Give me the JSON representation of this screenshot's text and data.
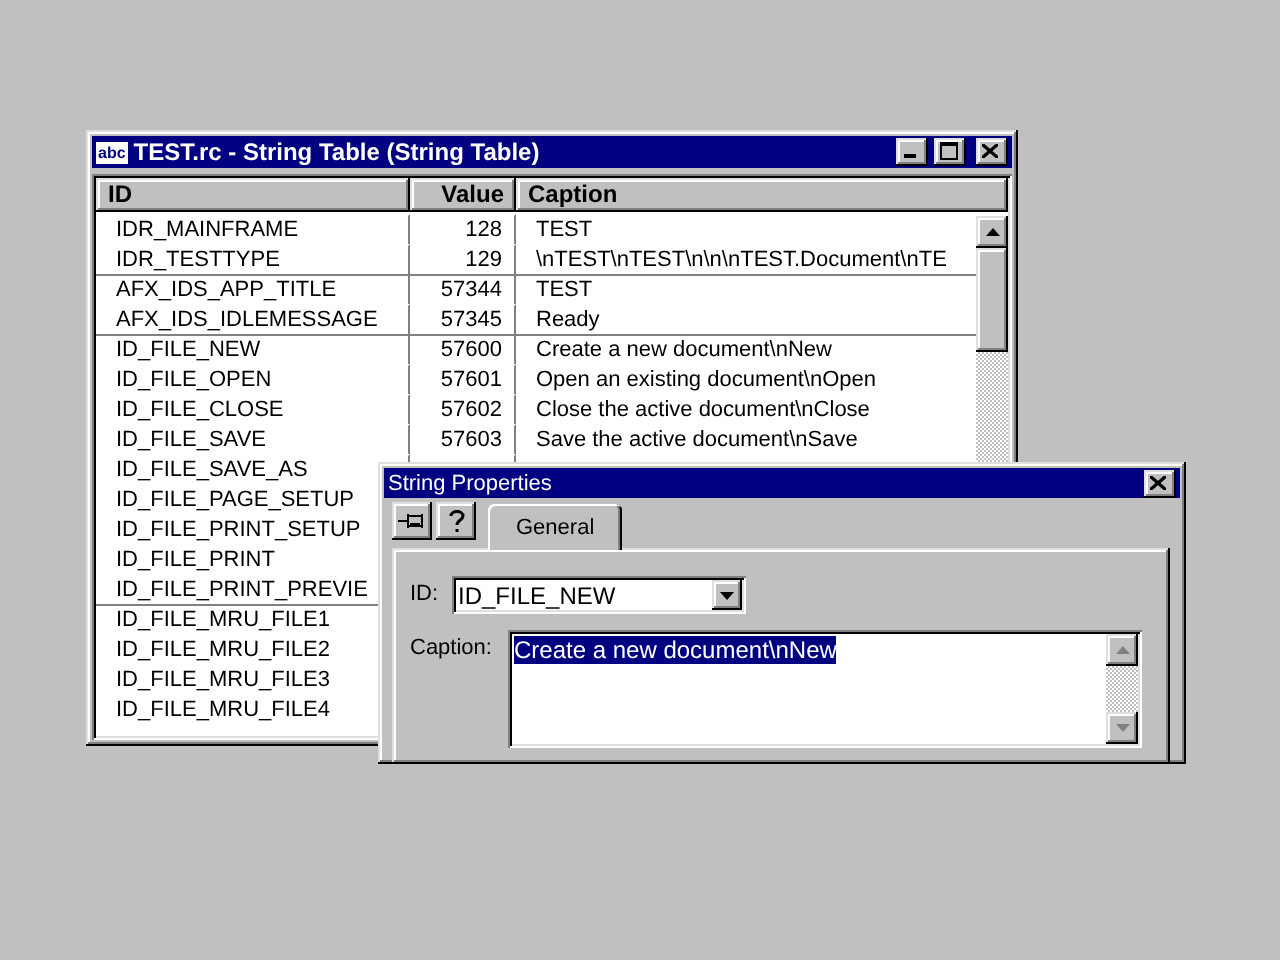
{
  "window": {
    "icon_label": "abc",
    "title": "TEST.rc - String Table (String Table)"
  },
  "table": {
    "columns": [
      "ID",
      "Value",
      "Caption"
    ],
    "rows": [
      {
        "id": "IDR_MAINFRAME",
        "value": "128",
        "caption": "TEST",
        "new_group": false
      },
      {
        "id": "IDR_TESTTYPE",
        "value": "129",
        "caption": "\\nTEST\\nTEST\\n\\n\\nTEST.Document\\nTE",
        "new_group": false
      },
      {
        "id": "AFX_IDS_APP_TITLE",
        "value": "57344",
        "caption": "TEST",
        "new_group": true
      },
      {
        "id": "AFX_IDS_IDLEMESSAGE",
        "value": "57345",
        "caption": "Ready",
        "new_group": false
      },
      {
        "id": "ID_FILE_NEW",
        "value": "57600",
        "caption": "Create a new document\\nNew",
        "new_group": true
      },
      {
        "id": "ID_FILE_OPEN",
        "value": "57601",
        "caption": "Open an existing document\\nOpen",
        "new_group": false
      },
      {
        "id": "ID_FILE_CLOSE",
        "value": "57602",
        "caption": "Close the active document\\nClose",
        "new_group": false
      },
      {
        "id": "ID_FILE_SAVE",
        "value": "57603",
        "caption": "Save the active document\\nSave",
        "new_group": false
      },
      {
        "id": "ID_FILE_SAVE_AS",
        "new_group": false
      },
      {
        "id": "ID_FILE_PAGE_SETUP",
        "new_group": false
      },
      {
        "id": "ID_FILE_PRINT_SETUP",
        "new_group": false
      },
      {
        "id": "ID_FILE_PRINT",
        "new_group": false
      },
      {
        "id": "ID_FILE_PRINT_PREVIE",
        "new_group": false
      },
      {
        "id": "ID_FILE_MRU_FILE1",
        "new_group": true
      },
      {
        "id": "ID_FILE_MRU_FILE2",
        "new_group": false
      },
      {
        "id": "ID_FILE_MRU_FILE3",
        "new_group": false
      },
      {
        "id": "ID_FILE_MRU_FILE4",
        "new_group": false
      }
    ]
  },
  "dialog": {
    "title": "String Properties",
    "tabs": [
      {
        "label": "General",
        "selected": true
      }
    ],
    "id_label": "ID:",
    "id_value": "ID_FILE_NEW",
    "caption_label": "Caption:",
    "caption_value": "Create a new document\\nNew",
    "caption_selected": true
  }
}
